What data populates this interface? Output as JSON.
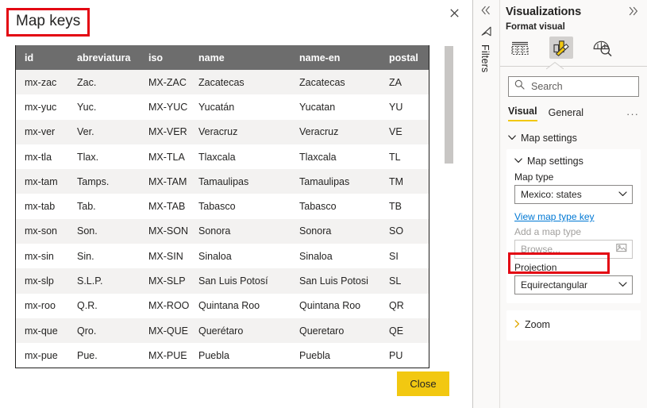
{
  "dialog": {
    "title": "Map keys",
    "close_icon": "close-icon",
    "close_button_label": "Close",
    "table": {
      "columns": [
        "id",
        "abreviatura",
        "iso",
        "name",
        "name-en",
        "postal"
      ],
      "rows": [
        [
          "mx-zac",
          "Zac.",
          "MX-ZAC",
          "Zacatecas",
          "Zacatecas",
          "ZA"
        ],
        [
          "mx-yuc",
          "Yuc.",
          "MX-YUC",
          "Yucatán",
          "Yucatan",
          "YU"
        ],
        [
          "mx-ver",
          "Ver.",
          "MX-VER",
          "Veracruz",
          "Veracruz",
          "VE"
        ],
        [
          "mx-tla",
          "Tlax.",
          "MX-TLA",
          "Tlaxcala",
          "Tlaxcala",
          "TL"
        ],
        [
          "mx-tam",
          "Tamps.",
          "MX-TAM",
          "Tamaulipas",
          "Tamaulipas",
          "TM"
        ],
        [
          "mx-tab",
          "Tab.",
          "MX-TAB",
          "Tabasco",
          "Tabasco",
          "TB"
        ],
        [
          "mx-son",
          "Son.",
          "MX-SON",
          "Sonora",
          "Sonora",
          "SO"
        ],
        [
          "mx-sin",
          "Sin.",
          "MX-SIN",
          "Sinaloa",
          "Sinaloa",
          "SI"
        ],
        [
          "mx-slp",
          "S.L.P.",
          "MX-SLP",
          "San Luis Potosí",
          "San Luis Potosi",
          "SL"
        ],
        [
          "mx-roo",
          "Q.R.",
          "MX-ROO",
          "Quintana Roo",
          "Quintana Roo",
          "QR"
        ],
        [
          "mx-que",
          "Qro.",
          "MX-QUE",
          "Querétaro",
          "Queretaro",
          "QE"
        ],
        [
          "mx-pue",
          "Pue.",
          "MX-PUE",
          "Puebla",
          "Puebla",
          "PU"
        ]
      ]
    }
  },
  "filters_rail": {
    "collapse_icon": "chevron-double-left-icon",
    "filter_icon": "filter-icon",
    "label": "Filters"
  },
  "visualizations": {
    "title": "Visualizations",
    "expand_icon": "chevron-double-right-icon",
    "format_visual_label": "Format visual",
    "icon_buttons": [
      {
        "name": "fields-icon",
        "selected": false
      },
      {
        "name": "format-visual-icon",
        "selected": true
      },
      {
        "name": "analytics-icon",
        "selected": false
      }
    ],
    "search": {
      "placeholder": "Search",
      "value": "",
      "icon": "search-icon"
    },
    "tabs": [
      {
        "label": "Visual",
        "active": true
      },
      {
        "label": "General",
        "active": false
      }
    ],
    "tabs_more": "···",
    "sections": {
      "map_settings_group": "Map settings",
      "map_settings_card": {
        "title": "Map settings",
        "map_type_label": "Map type",
        "map_type_value": "Mexico: states",
        "view_key_link": "View map type key",
        "add_map_type_label": "Add a map type",
        "browse_placeholder": "Browse...",
        "browse_icon": "image-browse-icon",
        "projection_label": "Projection",
        "projection_value": "Equirectangular"
      },
      "zoom_card": {
        "title": "Zoom"
      }
    }
  },
  "colors": {
    "accent_yellow": "#f2c811",
    "highlight_red": "#e30613",
    "link_blue": "#0078d4",
    "header_gray": "#6d6d6d"
  }
}
